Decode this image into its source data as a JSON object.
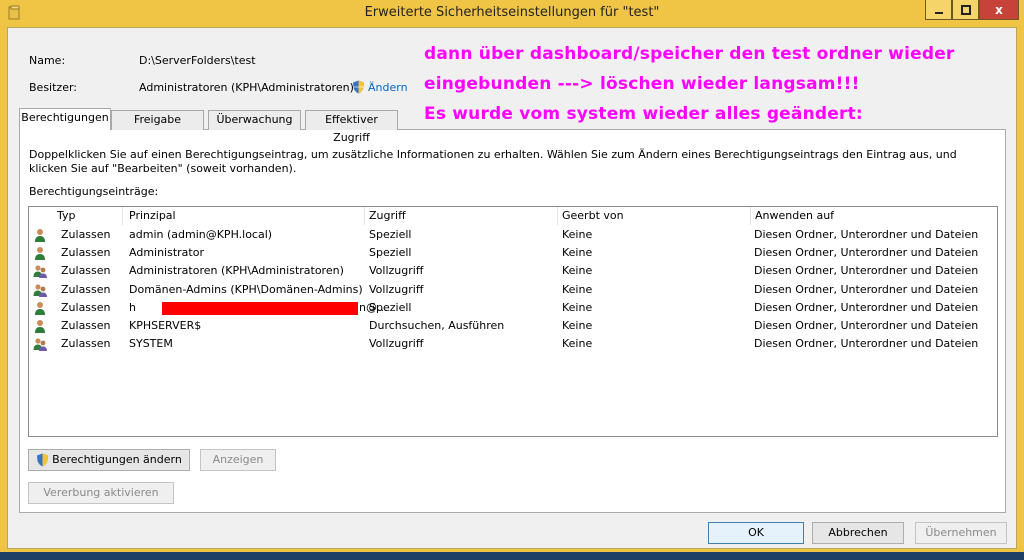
{
  "window": {
    "title": "Erweiterte Sicherheitseinstellungen für \"test\"",
    "close_label": "x"
  },
  "info": {
    "name_label": "Name:",
    "name_value": "D:\\ServerFolders\\test",
    "owner_label": "Besitzer:",
    "owner_value": "Administratoren (KPH\\Administratoren)",
    "change_link": "Ändern"
  },
  "annotation": {
    "line1": "dann über dashboard/speicher den test ordner wieder",
    "line2": "eingebunden ---> löschen wieder langsam!!!",
    "line3": "Es wurde vom system wieder alles geändert:"
  },
  "tabs": [
    "Berechtigungen",
    "Freigabe",
    "Überwachung",
    "Effektiver Zugriff"
  ],
  "description": "Doppelklicken Sie auf einen Berechtigungseintrag, um zusätzliche Informationen zu erhalten. Wählen Sie zum Ändern eines Berechtigungseintrags den Eintrag aus, und klicken Sie auf \"Bearbeiten\" (soweit vorhanden).",
  "entries_label": "Berechtigungseinträge:",
  "columns": [
    "Typ",
    "Prinzipal",
    "Zugriff",
    "Geerbt von",
    "Anwenden auf"
  ],
  "rows": [
    {
      "icon": "user-icon",
      "type": "Zulassen",
      "principal": "admin (admin@KPH.local)",
      "access": "Speziell",
      "inherited": "Keine",
      "applies": "Diesen Ordner, Unterordner und Dateien"
    },
    {
      "icon": "user-icon",
      "type": "Zulassen",
      "principal": "Administrator",
      "access": "Speziell",
      "inherited": "Keine",
      "applies": "Diesen Ordner, Unterordner und Dateien"
    },
    {
      "icon": "group-icon",
      "type": "Zulassen",
      "principal": "Administratoren (KPH\\Administratoren)",
      "access": "Vollzugriff",
      "inherited": "Keine",
      "applies": "Diesen Ordner, Unterordner und Dateien"
    },
    {
      "icon": "group-icon",
      "type": "Zulassen",
      "principal": "Domänen-Admins (KPH\\Domänen-Admins)",
      "access": "Vollzugriff",
      "inherited": "Keine",
      "applies": "Diesen Ordner, Unterordner und Dateien"
    },
    {
      "icon": "user-icon",
      "type": "Zulassen",
      "principal_start": "h",
      "principal_end": "n@...",
      "access": "Speziell",
      "inherited": "Keine",
      "applies": "Diesen Ordner, Unterordner und Dateien"
    },
    {
      "icon": "user-icon",
      "type": "Zulassen",
      "principal": "KPHSERVER$",
      "access": "Durchsuchen, Ausführen",
      "inherited": "Keine",
      "applies": "Diesen Ordner, Unterordner und Dateien"
    },
    {
      "icon": "group-icon",
      "type": "Zulassen",
      "principal": "SYSTEM",
      "access": "Vollzugriff",
      "inherited": "Keine",
      "applies": "Diesen Ordner, Unterordner und Dateien"
    }
  ],
  "buttons": {
    "change_permissions": "Berechtigungen ändern",
    "show": "Anzeigen",
    "enable_inheritance": "Vererbung aktivieren",
    "ok": "OK",
    "cancel": "Abbrechen",
    "apply": "Übernehmen"
  },
  "colors": {
    "annotation": "#ff00ff",
    "redaction": "#ff0000",
    "frame": "#f0c545",
    "link": "#0066cc"
  }
}
